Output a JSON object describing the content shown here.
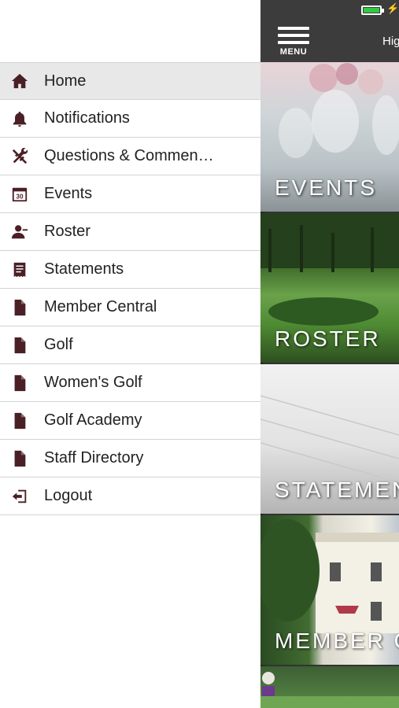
{
  "drawer": {
    "items": [
      {
        "label": "Home",
        "icon": "home-icon",
        "active": true
      },
      {
        "label": "Notifications",
        "icon": "bell-icon"
      },
      {
        "label": "Questions & Commen…",
        "icon": "tools-icon"
      },
      {
        "label": "Events",
        "icon": "calendar-icon",
        "icon_text": "30"
      },
      {
        "label": "Roster",
        "icon": "person-icon"
      },
      {
        "label": "Statements",
        "icon": "statement-icon"
      },
      {
        "label": "Member Central",
        "icon": "document-icon"
      },
      {
        "label": "Golf",
        "icon": "document-icon"
      },
      {
        "label": "Women's Golf",
        "icon": "document-icon"
      },
      {
        "label": "Golf Academy",
        "icon": "document-icon"
      },
      {
        "label": "Staff Directory",
        "icon": "document-icon"
      },
      {
        "label": "Logout",
        "icon": "logout-icon"
      }
    ]
  },
  "header": {
    "menu_label": "MENU",
    "greeting": "Hig"
  },
  "tiles": [
    {
      "title": "EVENTS"
    },
    {
      "title": "ROSTER"
    },
    {
      "title": "STATEMEN"
    },
    {
      "title": "MEMBER C"
    },
    {
      "title": ""
    }
  ],
  "colors": {
    "icon": "#4a1f25",
    "active_row": "#e8e8e8",
    "header_bg": "#3c3c3c",
    "battery": "#2ecc40"
  }
}
